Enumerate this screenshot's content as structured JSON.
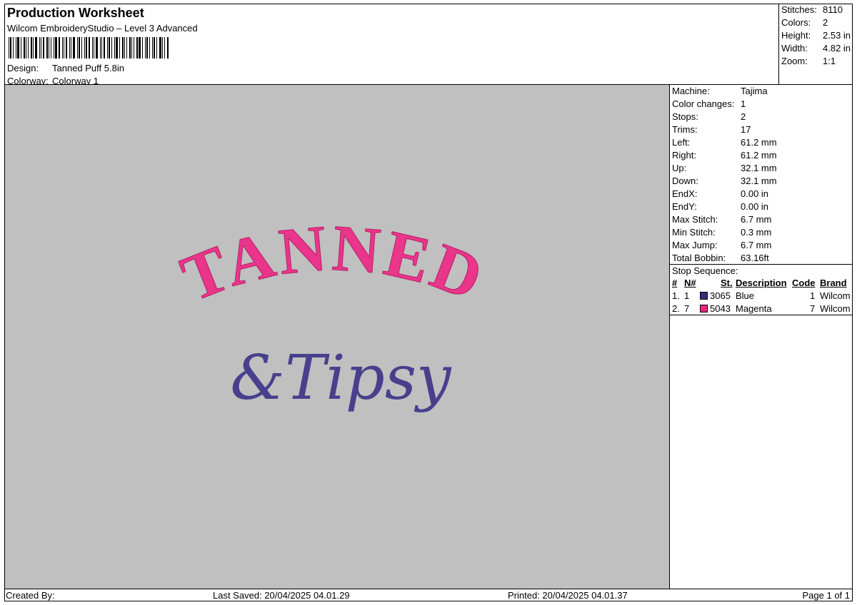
{
  "header": {
    "title": "Production Worksheet",
    "subtitle": "Wilcom EmbroideryStudio – Level 3 Advanced",
    "design_label": "Design:",
    "design_value": "Tanned Puff 5.8in",
    "colorway_label": "Colorway:",
    "colorway_value": "Colorway 1"
  },
  "summary": [
    {
      "label": "Stitches:",
      "value": "8110"
    },
    {
      "label": "Colors:",
      "value": "2"
    },
    {
      "label": "Height:",
      "value": "2.53 in"
    },
    {
      "label": "Width:",
      "value": "4.82 in"
    },
    {
      "label": "Zoom:",
      "value": "1:1"
    }
  ],
  "machine_info": [
    {
      "label": "Machine:",
      "value": "Tajima"
    },
    {
      "label": "Color changes:",
      "value": "1"
    },
    {
      "label": "Stops:",
      "value": "2"
    },
    {
      "label": "Trims:",
      "value": "17"
    },
    {
      "label": "Left:",
      "value": "61.2 mm"
    },
    {
      "label": "Right:",
      "value": "61.2 mm"
    },
    {
      "label": "Up:",
      "value": "32.1 mm"
    },
    {
      "label": "Down:",
      "value": "32.1 mm"
    },
    {
      "label": "EndX:",
      "value": "0.00 in"
    },
    {
      "label": "EndY:",
      "value": "0.00 in"
    },
    {
      "label": "Max Stitch:",
      "value": "6.7 mm"
    },
    {
      "label": "Min Stitch:",
      "value": "0.3 mm"
    },
    {
      "label": "Max Jump:",
      "value": "6.7 mm"
    },
    {
      "label": "Total Bobbin:",
      "value": "63.16ft"
    }
  ],
  "stop_sequence": {
    "title": "Stop Sequence:",
    "columns": [
      "#",
      "N#",
      "St.",
      "Description",
      "Code",
      "Brand"
    ],
    "rows": [
      {
        "num": "1.",
        "n": "1",
        "st": "3065",
        "description": "Blue",
        "code": "1",
        "brand": "Wilcom",
        "color": "#2e2f7f"
      },
      {
        "num": "2.",
        "n": "7",
        "st": "5043",
        "description": "Magenta",
        "code": "7",
        "brand": "Wilcom",
        "color": "#e8287f"
      }
    ]
  },
  "design_preview": {
    "line1": "TANNED",
    "line2": "&Tipsy",
    "line1_color": "#e9358a",
    "line2_color": "#4a3f8c",
    "background": "#c0c0c0"
  },
  "footer": {
    "created_by": "Created By:",
    "last_saved": "Last Saved: 20/04/2025 04.01.29",
    "printed": "Printed: 20/04/2025 04.01.37",
    "page": "Page 1 of 1"
  }
}
